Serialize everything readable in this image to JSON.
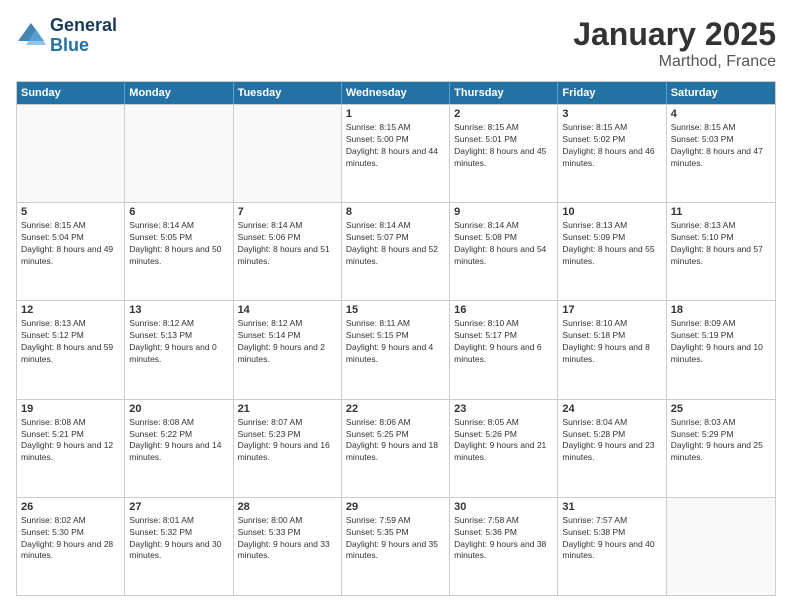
{
  "header": {
    "logo_general": "General",
    "logo_blue": "Blue",
    "title": "January 2025",
    "location": "Marthod, France"
  },
  "weekdays": [
    "Sunday",
    "Monday",
    "Tuesday",
    "Wednesday",
    "Thursday",
    "Friday",
    "Saturday"
  ],
  "weeks": [
    [
      {
        "day": "",
        "sunrise": "",
        "sunset": "",
        "daylight": "",
        "empty": true
      },
      {
        "day": "",
        "sunrise": "",
        "sunset": "",
        "daylight": "",
        "empty": true
      },
      {
        "day": "",
        "sunrise": "",
        "sunset": "",
        "daylight": "",
        "empty": true
      },
      {
        "day": "1",
        "sunrise": "Sunrise: 8:15 AM",
        "sunset": "Sunset: 5:00 PM",
        "daylight": "Daylight: 8 hours and 44 minutes.",
        "empty": false
      },
      {
        "day": "2",
        "sunrise": "Sunrise: 8:15 AM",
        "sunset": "Sunset: 5:01 PM",
        "daylight": "Daylight: 8 hours and 45 minutes.",
        "empty": false
      },
      {
        "day": "3",
        "sunrise": "Sunrise: 8:15 AM",
        "sunset": "Sunset: 5:02 PM",
        "daylight": "Daylight: 8 hours and 46 minutes.",
        "empty": false
      },
      {
        "day": "4",
        "sunrise": "Sunrise: 8:15 AM",
        "sunset": "Sunset: 5:03 PM",
        "daylight": "Daylight: 8 hours and 47 minutes.",
        "empty": false
      }
    ],
    [
      {
        "day": "5",
        "sunrise": "Sunrise: 8:15 AM",
        "sunset": "Sunset: 5:04 PM",
        "daylight": "Daylight: 8 hours and 49 minutes.",
        "empty": false
      },
      {
        "day": "6",
        "sunrise": "Sunrise: 8:14 AM",
        "sunset": "Sunset: 5:05 PM",
        "daylight": "Daylight: 8 hours and 50 minutes.",
        "empty": false
      },
      {
        "day": "7",
        "sunrise": "Sunrise: 8:14 AM",
        "sunset": "Sunset: 5:06 PM",
        "daylight": "Daylight: 8 hours and 51 minutes.",
        "empty": false
      },
      {
        "day": "8",
        "sunrise": "Sunrise: 8:14 AM",
        "sunset": "Sunset: 5:07 PM",
        "daylight": "Daylight: 8 hours and 52 minutes.",
        "empty": false
      },
      {
        "day": "9",
        "sunrise": "Sunrise: 8:14 AM",
        "sunset": "Sunset: 5:08 PM",
        "daylight": "Daylight: 8 hours and 54 minutes.",
        "empty": false
      },
      {
        "day": "10",
        "sunrise": "Sunrise: 8:13 AM",
        "sunset": "Sunset: 5:09 PM",
        "daylight": "Daylight: 8 hours and 55 minutes.",
        "empty": false
      },
      {
        "day": "11",
        "sunrise": "Sunrise: 8:13 AM",
        "sunset": "Sunset: 5:10 PM",
        "daylight": "Daylight: 8 hours and 57 minutes.",
        "empty": false
      }
    ],
    [
      {
        "day": "12",
        "sunrise": "Sunrise: 8:13 AM",
        "sunset": "Sunset: 5:12 PM",
        "daylight": "Daylight: 8 hours and 59 minutes.",
        "empty": false
      },
      {
        "day": "13",
        "sunrise": "Sunrise: 8:12 AM",
        "sunset": "Sunset: 5:13 PM",
        "daylight": "Daylight: 9 hours and 0 minutes.",
        "empty": false
      },
      {
        "day": "14",
        "sunrise": "Sunrise: 8:12 AM",
        "sunset": "Sunset: 5:14 PM",
        "daylight": "Daylight: 9 hours and 2 minutes.",
        "empty": false
      },
      {
        "day": "15",
        "sunrise": "Sunrise: 8:11 AM",
        "sunset": "Sunset: 5:15 PM",
        "daylight": "Daylight: 9 hours and 4 minutes.",
        "empty": false
      },
      {
        "day": "16",
        "sunrise": "Sunrise: 8:10 AM",
        "sunset": "Sunset: 5:17 PM",
        "daylight": "Daylight: 9 hours and 6 minutes.",
        "empty": false
      },
      {
        "day": "17",
        "sunrise": "Sunrise: 8:10 AM",
        "sunset": "Sunset: 5:18 PM",
        "daylight": "Daylight: 9 hours and 8 minutes.",
        "empty": false
      },
      {
        "day": "18",
        "sunrise": "Sunrise: 8:09 AM",
        "sunset": "Sunset: 5:19 PM",
        "daylight": "Daylight: 9 hours and 10 minutes.",
        "empty": false
      }
    ],
    [
      {
        "day": "19",
        "sunrise": "Sunrise: 8:08 AM",
        "sunset": "Sunset: 5:21 PM",
        "daylight": "Daylight: 9 hours and 12 minutes.",
        "empty": false
      },
      {
        "day": "20",
        "sunrise": "Sunrise: 8:08 AM",
        "sunset": "Sunset: 5:22 PM",
        "daylight": "Daylight: 9 hours and 14 minutes.",
        "empty": false
      },
      {
        "day": "21",
        "sunrise": "Sunrise: 8:07 AM",
        "sunset": "Sunset: 5:23 PM",
        "daylight": "Daylight: 9 hours and 16 minutes.",
        "empty": false
      },
      {
        "day": "22",
        "sunrise": "Sunrise: 8:06 AM",
        "sunset": "Sunset: 5:25 PM",
        "daylight": "Daylight: 9 hours and 18 minutes.",
        "empty": false
      },
      {
        "day": "23",
        "sunrise": "Sunrise: 8:05 AM",
        "sunset": "Sunset: 5:26 PM",
        "daylight": "Daylight: 9 hours and 21 minutes.",
        "empty": false
      },
      {
        "day": "24",
        "sunrise": "Sunrise: 8:04 AM",
        "sunset": "Sunset: 5:28 PM",
        "daylight": "Daylight: 9 hours and 23 minutes.",
        "empty": false
      },
      {
        "day": "25",
        "sunrise": "Sunrise: 8:03 AM",
        "sunset": "Sunset: 5:29 PM",
        "daylight": "Daylight: 9 hours and 25 minutes.",
        "empty": false
      }
    ],
    [
      {
        "day": "26",
        "sunrise": "Sunrise: 8:02 AM",
        "sunset": "Sunset: 5:30 PM",
        "daylight": "Daylight: 9 hours and 28 minutes.",
        "empty": false
      },
      {
        "day": "27",
        "sunrise": "Sunrise: 8:01 AM",
        "sunset": "Sunset: 5:32 PM",
        "daylight": "Daylight: 9 hours and 30 minutes.",
        "empty": false
      },
      {
        "day": "28",
        "sunrise": "Sunrise: 8:00 AM",
        "sunset": "Sunset: 5:33 PM",
        "daylight": "Daylight: 9 hours and 33 minutes.",
        "empty": false
      },
      {
        "day": "29",
        "sunrise": "Sunrise: 7:59 AM",
        "sunset": "Sunset: 5:35 PM",
        "daylight": "Daylight: 9 hours and 35 minutes.",
        "empty": false
      },
      {
        "day": "30",
        "sunrise": "Sunrise: 7:58 AM",
        "sunset": "Sunset: 5:36 PM",
        "daylight": "Daylight: 9 hours and 38 minutes.",
        "empty": false
      },
      {
        "day": "31",
        "sunrise": "Sunrise: 7:57 AM",
        "sunset": "Sunset: 5:38 PM",
        "daylight": "Daylight: 9 hours and 40 minutes.",
        "empty": false
      },
      {
        "day": "",
        "sunrise": "",
        "sunset": "",
        "daylight": "",
        "empty": true
      }
    ]
  ]
}
